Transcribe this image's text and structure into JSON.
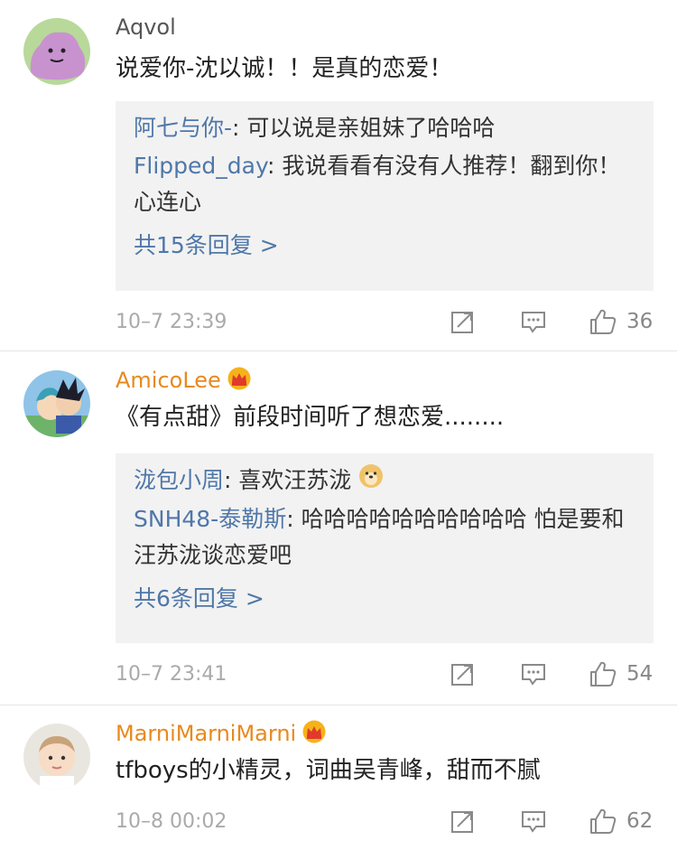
{
  "comments": [
    {
      "username": "Aqvol",
      "vip": false,
      "text": "说爱你-沈以诚！！是真的恋爱！",
      "replies": [
        {
          "name": "阿七与你-",
          "text": "可以说是亲姐妹了哈哈哈"
        },
        {
          "name": "Flipped_day",
          "text": "我说看看有没有人推荐！翻到你！心连心"
        }
      ],
      "more": "共15条回复 >",
      "time": "10–7 23:39",
      "likes": "36"
    },
    {
      "username": "AmicoLee",
      "vip": true,
      "text": "《有点甜》前段时间听了想恋爱........",
      "replies": [
        {
          "name": "泷包小周",
          "text": "喜欢汪苏泷"
        },
        {
          "name": "SNH48-泰勒斯",
          "text": "哈哈哈哈哈哈哈哈哈哈 怕是要和汪苏泷谈恋爱吧"
        }
      ],
      "more": "共6条回复 >",
      "time": "10–7 23:41",
      "likes": "54"
    },
    {
      "username": "MarniMarniMarni",
      "vip": true,
      "text": "tfboys的小精灵，词曲吴青峰，甜而不腻",
      "time": "10–8 00:02",
      "likes": "62"
    }
  ],
  "colors": {
    "name_link": "#4f77a9",
    "vip_name": "#e8891e",
    "reply_bg": "#f2f2f2"
  },
  "icons": {
    "repost": "repost-icon",
    "comment": "comment-icon",
    "like": "like-icon",
    "crown": "vip-crown-icon",
    "doge": "doge-emoji-icon"
  }
}
